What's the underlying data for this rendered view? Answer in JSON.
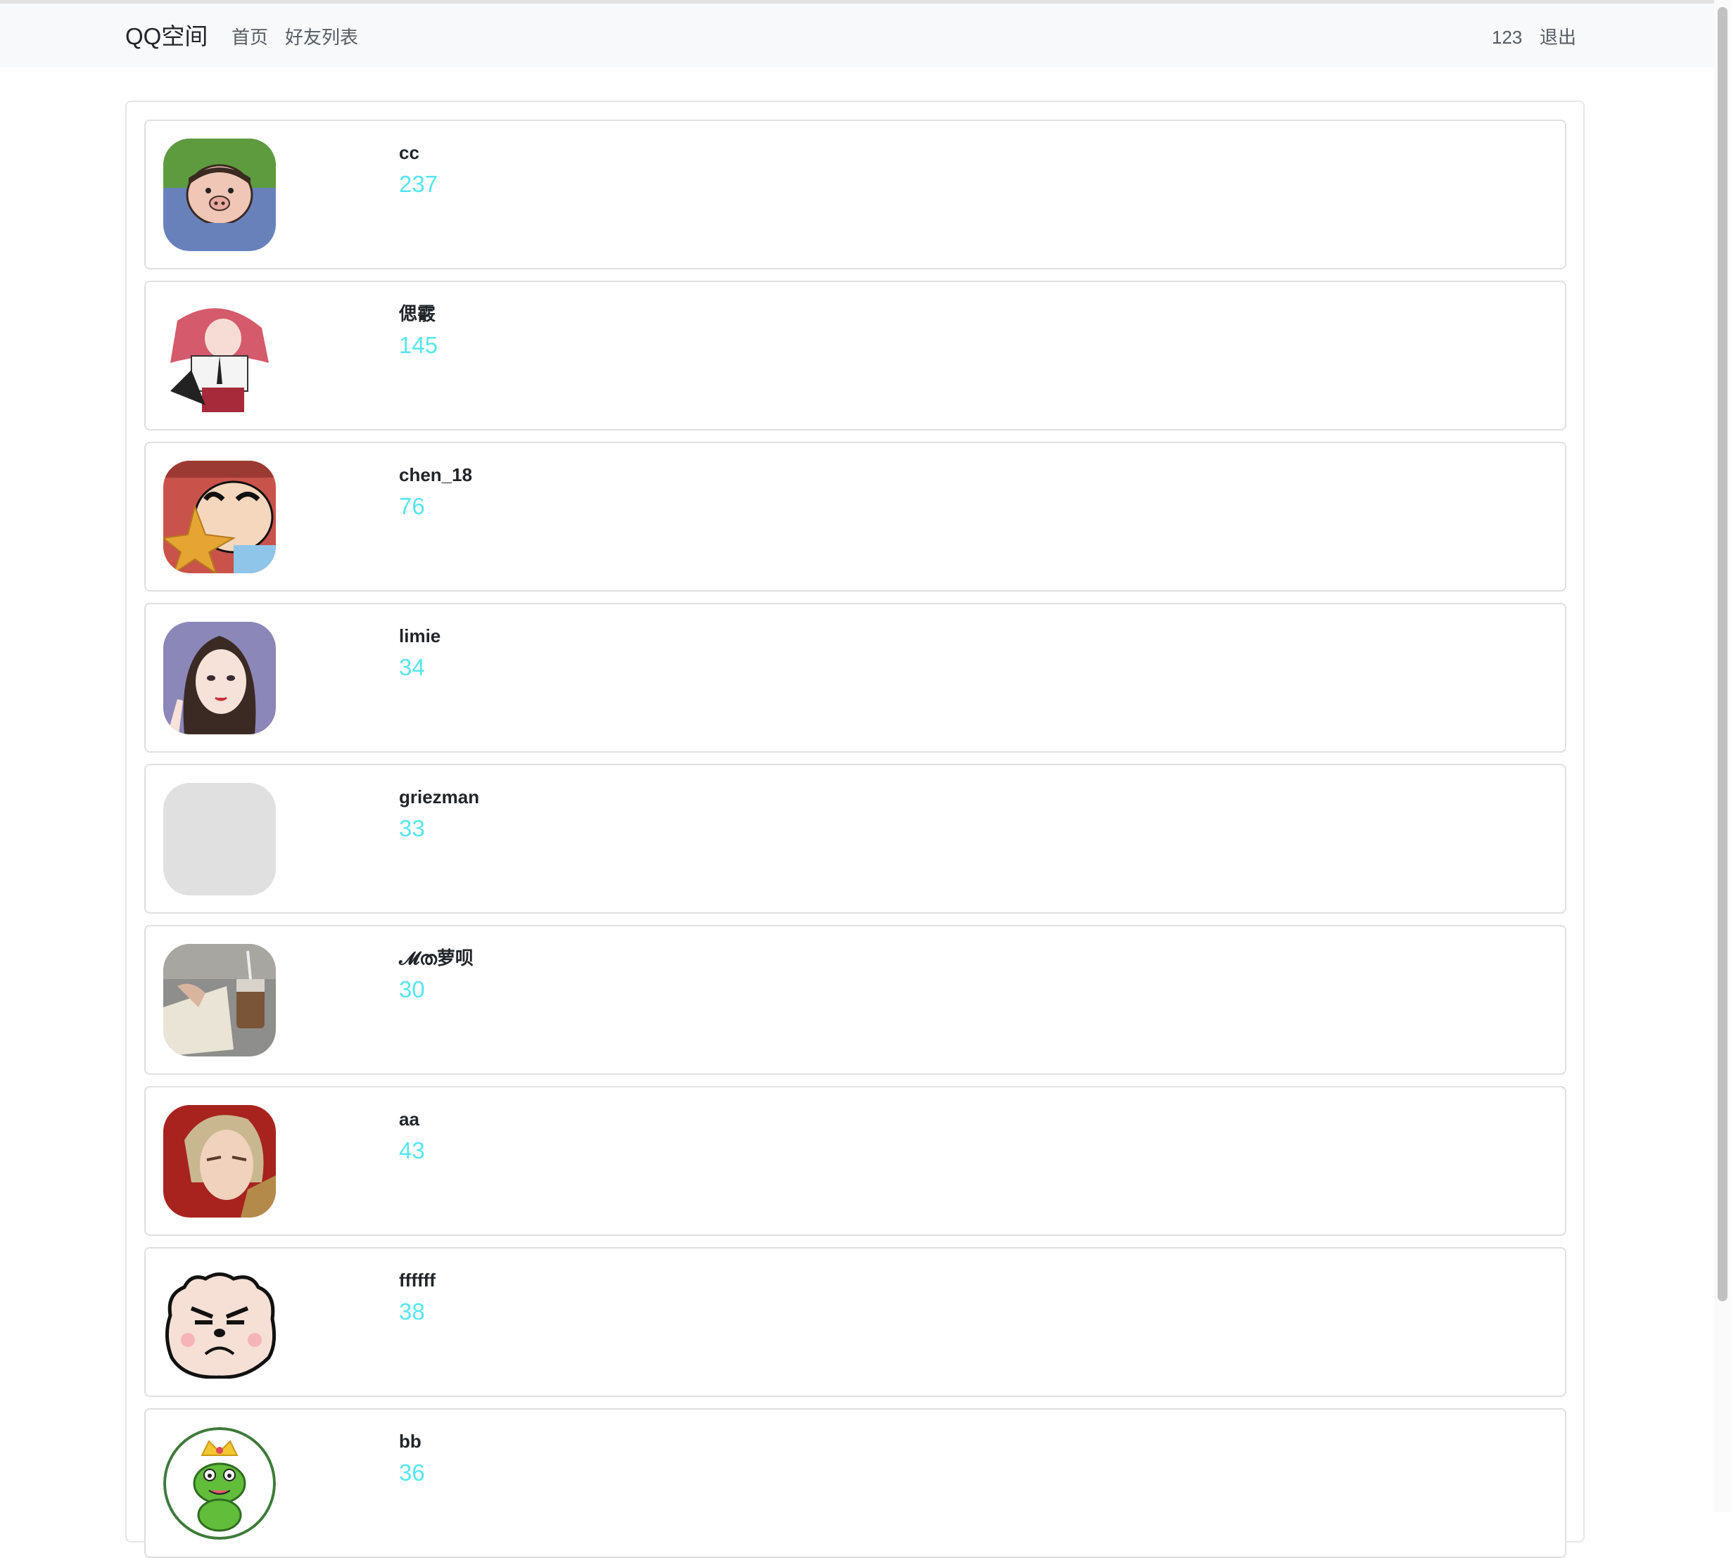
{
  "navbar": {
    "brand": "QQ空间",
    "home": "首页",
    "friends": "好友列表",
    "user": "123",
    "logout": "退出"
  },
  "friends": [
    {
      "name": "cc",
      "count": "237"
    },
    {
      "name": "偲霰",
      "count": "145"
    },
    {
      "name": "chen_18",
      "count": "76"
    },
    {
      "name": "limie",
      "count": "34"
    },
    {
      "name": "griezman",
      "count": "33"
    },
    {
      "name": "𝓜ത萝呗",
      "count": "30"
    },
    {
      "name": "aa",
      "count": "43"
    },
    {
      "name": "ffffff",
      "count": "38"
    },
    {
      "name": "bb",
      "count": "36"
    }
  ],
  "colors": {
    "count": "#55e5ef",
    "navbar_bg": "#f8f9fa"
  }
}
